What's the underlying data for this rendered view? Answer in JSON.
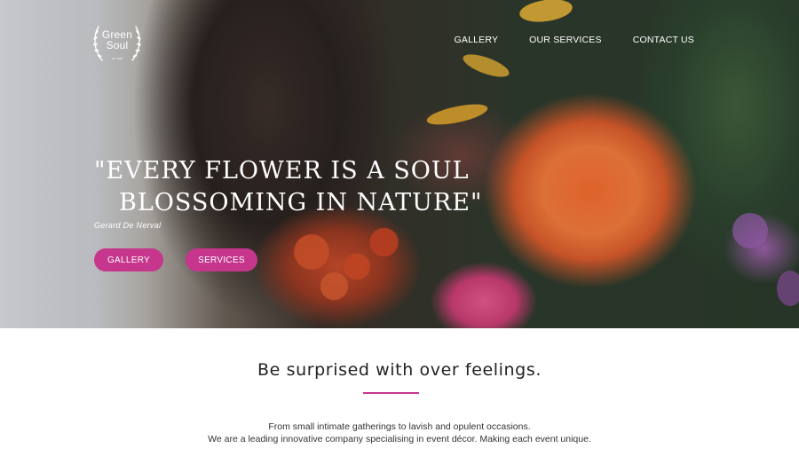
{
  "logo": {
    "line1": "Green",
    "line2": "Soul",
    "est": "est. 2015"
  },
  "nav": {
    "items": [
      {
        "label": "GALLERY"
      },
      {
        "label": "OUR SERVICES"
      },
      {
        "label": "CONTACT US"
      }
    ]
  },
  "hero": {
    "quote_line1": "\"EVERY FLOWER IS A SOUL",
    "quote_line2": "BLOSSOMING IN NATURE\"",
    "author": "Gerard De Nerval",
    "buttons": {
      "gallery": "GALLERY",
      "services": "SERVICES"
    }
  },
  "content": {
    "headline": "Be surprised with over feelings.",
    "desc_line1": "From small intimate gatherings to lavish and opulent occasions.",
    "desc_line2": "We are a leading innovative company specialising in event décor. Making each event unique."
  },
  "colors": {
    "accent": "#c5368c",
    "text_dark": "#222222",
    "white": "#ffffff"
  },
  "icons": {
    "logo_wreath": "laurel-wreath-icon"
  }
}
